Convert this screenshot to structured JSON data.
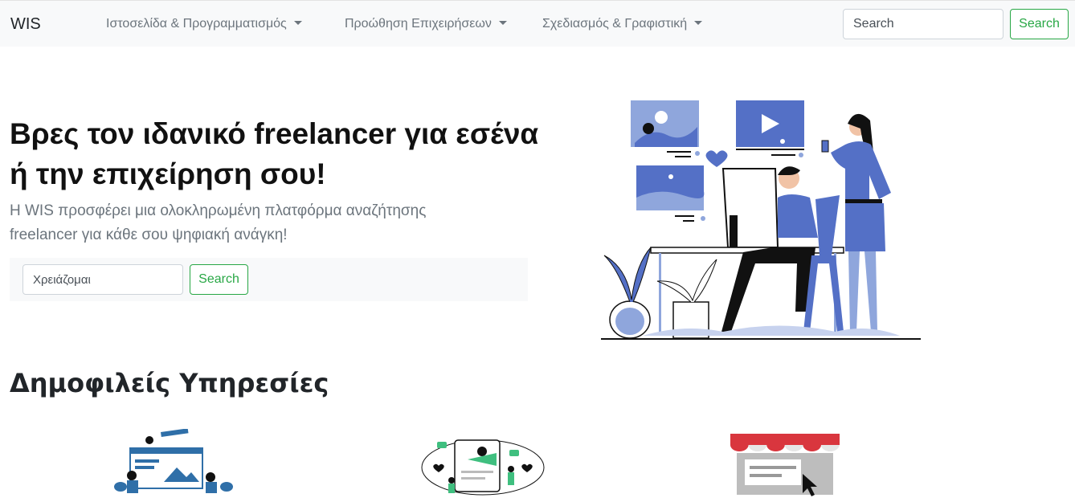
{
  "navbar": {
    "brand": "WIS",
    "items": [
      {
        "label": "Ιστοσελίδα & Προγραμματισμός"
      },
      {
        "label": "Προώθηση Επιχειρήσεων"
      },
      {
        "label": "Σχεδιασμός & Γραφιστική"
      }
    ],
    "search": {
      "placeholder": "Search",
      "button_label": "Search"
    }
  },
  "hero": {
    "title_line1": "Βρες τον ιδανικό freelancer για εσένα",
    "title_line2": "ή την επιχείρηση σου!",
    "subtitle_line1": "Η WIS προσφέρει μια ολοκληρωμένη πλατφόρμα αναζήτησης",
    "subtitle_line2": "freelancer για κάθε σου ψηφιακή ανάγκη!",
    "search": {
      "placeholder": "Χρειάζομαι",
      "button_label": "Search"
    }
  },
  "popular": {
    "title": "Δημοφιλείς Υπηρεσίες",
    "services": [
      {
        "icon": "web-development-icon"
      },
      {
        "icon": "business-promotion-icon"
      },
      {
        "icon": "shop-design-icon"
      }
    ]
  },
  "colors": {
    "accent": "#28a745",
    "illustration_blue": "#5470c6",
    "navbar_bg": "#f8f9fa",
    "awning_red": "#d9363e"
  }
}
